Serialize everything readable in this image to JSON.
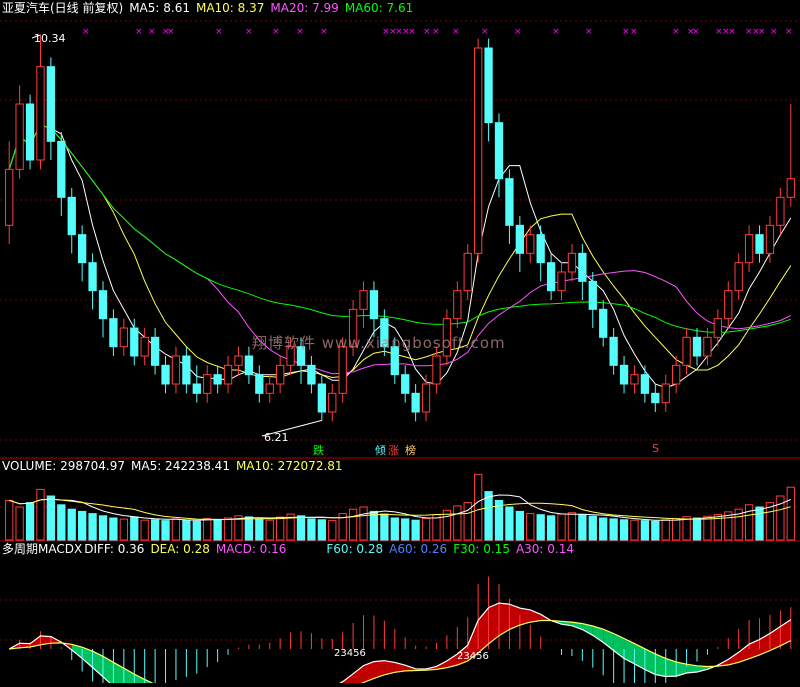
{
  "colors": {
    "up": "#ff3c3c",
    "down": "#54fcfc",
    "ma5": "#ffffff",
    "ma10": "#ffff54",
    "ma20": "#ff54ff",
    "ma60": "#00ff00",
    "grid": "#7a0000",
    "fuchsia": "#ff00ff",
    "green": "#00c060",
    "red": "#c00000"
  },
  "price_header": {
    "title": "亚夏汽车(日线 前复权)",
    "ma5": "MA5: 8.61",
    "ma10": "MA10: 8.37",
    "ma20": "MA20: 7.99",
    "ma60": "MA60: 7.61"
  },
  "volume_header": {
    "label": "VOLUME: 298704.97",
    "ma5": "MA5: 242238.41",
    "ma10": "MA10: 272072.81"
  },
  "macd_header": {
    "label": "多周期MACDX",
    "diff": "DIFF: 0.36",
    "dea": "DEA: 0.28",
    "macd": "MACD: 0.16",
    "f60": "F60: 0.28",
    "a60": "A60: 0.26",
    "f30": "F30: 0.15",
    "a30": "A30: 0.14"
  },
  "annotations": {
    "high": "10.34",
    "low": "6.21",
    "watermark": "翔博软件 www.xiangbosoft.com",
    "signal_die": "跌",
    "signal_qing": "倾",
    "signal_zhang": "涨",
    "signal_bang": "榜",
    "signal_s": "S",
    "label_a": "23456",
    "label_b": "23456"
  },
  "chart_data": {
    "type": "candlestick",
    "price_range": [
      6.0,
      10.5
    ],
    "volume_max": 300000,
    "macd_range": [
      -0.3,
      0.9
    ],
    "candles": [
      [
        8.3,
        8.9,
        9.2,
        8.1
      ],
      [
        8.9,
        9.6,
        9.8,
        8.8
      ],
      [
        9.6,
        9.0,
        9.7,
        8.9
      ],
      [
        9.0,
        10.0,
        10.34,
        8.9
      ],
      [
        10.0,
        9.2,
        10.1,
        9.0
      ],
      [
        9.2,
        8.6,
        9.3,
        8.4
      ],
      [
        8.6,
        8.2,
        8.7,
        8.0
      ],
      [
        8.2,
        7.9,
        8.3,
        7.7
      ],
      [
        7.9,
        7.6,
        8.0,
        7.4
      ],
      [
        7.6,
        7.3,
        7.7,
        7.1
      ],
      [
        7.3,
        7.0,
        7.4,
        6.9
      ],
      [
        7.0,
        7.2,
        7.3,
        6.9
      ],
      [
        7.2,
        6.9,
        7.3,
        6.8
      ],
      [
        6.9,
        7.1,
        7.2,
        6.8
      ],
      [
        7.1,
        6.8,
        7.2,
        6.7
      ],
      [
        6.8,
        6.6,
        6.9,
        6.5
      ],
      [
        6.6,
        6.9,
        7.0,
        6.5
      ],
      [
        6.9,
        6.6,
        7.0,
        6.5
      ],
      [
        6.6,
        6.5,
        6.8,
        6.4
      ],
      [
        6.5,
        6.7,
        6.8,
        6.4
      ],
      [
        6.7,
        6.6,
        6.8,
        6.5
      ],
      [
        6.6,
        6.8,
        6.9,
        6.5
      ],
      [
        6.8,
        6.9,
        7.0,
        6.7
      ],
      [
        6.9,
        6.7,
        7.0,
        6.6
      ],
      [
        6.7,
        6.5,
        6.8,
        6.4
      ],
      [
        6.5,
        6.6,
        6.7,
        6.4
      ],
      [
        6.6,
        6.8,
        6.9,
        6.5
      ],
      [
        6.8,
        7.0,
        7.1,
        6.7
      ],
      [
        7.0,
        6.8,
        7.1,
        6.6
      ],
      [
        6.8,
        6.6,
        6.9,
        6.5
      ],
      [
        6.6,
        6.3,
        6.7,
        6.21
      ],
      [
        6.3,
        6.5,
        6.6,
        6.2
      ],
      [
        6.5,
        7.0,
        7.1,
        6.4
      ],
      [
        7.0,
        7.4,
        7.5,
        6.9
      ],
      [
        7.4,
        7.6,
        7.7,
        7.2
      ],
      [
        7.6,
        7.3,
        7.7,
        7.1
      ],
      [
        7.3,
        7.0,
        7.4,
        6.9
      ],
      [
        7.0,
        6.7,
        7.1,
        6.6
      ],
      [
        6.7,
        6.5,
        6.8,
        6.4
      ],
      [
        6.5,
        6.3,
        6.6,
        6.2
      ],
      [
        6.3,
        6.6,
        6.7,
        6.2
      ],
      [
        6.6,
        6.9,
        7.0,
        6.5
      ],
      [
        6.9,
        7.3,
        7.4,
        6.8
      ],
      [
        7.3,
        7.6,
        7.7,
        7.2
      ],
      [
        7.6,
        8.0,
        8.1,
        7.5
      ],
      [
        8.0,
        10.2,
        10.3,
        7.9
      ],
      [
        10.2,
        9.4,
        10.3,
        9.2
      ],
      [
        9.4,
        8.8,
        9.5,
        8.6
      ],
      [
        8.8,
        8.3,
        8.9,
        8.1
      ],
      [
        8.3,
        8.0,
        8.4,
        7.8
      ],
      [
        8.0,
        8.2,
        8.3,
        7.9
      ],
      [
        8.2,
        7.9,
        8.3,
        7.7
      ],
      [
        7.9,
        7.6,
        8.0,
        7.5
      ],
      [
        7.6,
        7.8,
        7.9,
        7.5
      ],
      [
        7.8,
        8.0,
        8.1,
        7.7
      ],
      [
        8.0,
        7.7,
        8.1,
        7.5
      ],
      [
        7.7,
        7.4,
        7.8,
        7.2
      ],
      [
        7.4,
        7.1,
        7.5,
        7.0
      ],
      [
        7.1,
        6.8,
        7.2,
        6.7
      ],
      [
        6.8,
        6.6,
        6.9,
        6.5
      ],
      [
        6.6,
        6.7,
        6.8,
        6.5
      ],
      [
        6.7,
        6.5,
        6.8,
        6.4
      ],
      [
        6.5,
        6.4,
        6.6,
        6.3
      ],
      [
        6.4,
        6.6,
        6.7,
        6.3
      ],
      [
        6.6,
        6.8,
        6.9,
        6.5
      ],
      [
        6.8,
        7.1,
        7.2,
        6.7
      ],
      [
        7.1,
        6.9,
        7.2,
        6.8
      ],
      [
        6.9,
        7.1,
        7.2,
        6.8
      ],
      [
        7.1,
        7.3,
        7.4,
        7.0
      ],
      [
        7.3,
        7.6,
        7.7,
        7.2
      ],
      [
        7.6,
        7.9,
        8.0,
        7.5
      ],
      [
        7.9,
        8.2,
        8.3,
        7.8
      ],
      [
        8.2,
        8.0,
        8.3,
        7.9
      ],
      [
        8.0,
        8.3,
        8.4,
        7.9
      ],
      [
        8.3,
        8.6,
        8.7,
        8.2
      ],
      [
        8.6,
        8.8,
        9.6,
        8.5
      ]
    ],
    "volumes": [
      180000,
      150000,
      170000,
      230000,
      200000,
      160000,
      140000,
      130000,
      120000,
      110000,
      100000,
      95000,
      105000,
      90000,
      92000,
      88000,
      96000,
      90000,
      85000,
      98000,
      94000,
      100000,
      110000,
      105000,
      96000,
      90000,
      104000,
      118000,
      110000,
      96000,
      92000,
      88000,
      120000,
      140000,
      150000,
      130000,
      118000,
      100000,
      96000,
      90000,
      98000,
      115000,
      135000,
      155000,
      170000,
      298704.97,
      220000,
      180000,
      150000,
      130000,
      120000,
      115000,
      110000,
      118000,
      124000,
      116000,
      108000,
      100000,
      96000,
      92000,
      90000,
      88000,
      85000,
      92000,
      98000,
      106000,
      100000,
      108000,
      116000,
      128000,
      140000,
      160000,
      150000,
      170000,
      200000,
      240000
    ],
    "ma_current": {
      "ma5": 8.61,
      "ma10": 8.37,
      "ma20": 7.99,
      "ma60": 7.61
    },
    "macd": {
      "diff": 0.36,
      "dea": 0.28,
      "macd": 0.16,
      "f60": 0.28,
      "a60": 0.26,
      "f30": 0.15,
      "a30": 0.14
    }
  }
}
